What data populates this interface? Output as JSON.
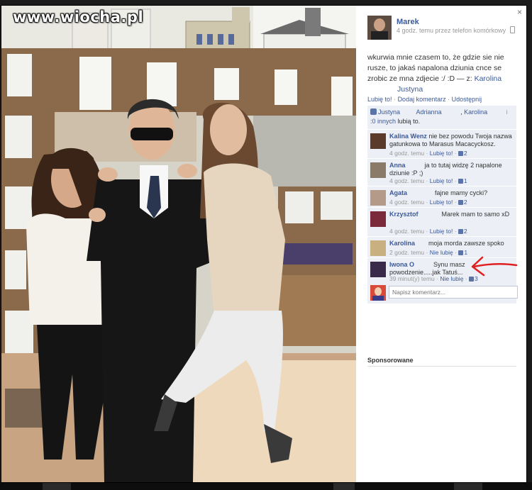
{
  "watermark": "www.wiocha.pl",
  "close_label": "×",
  "author": {
    "name": "Marek",
    "meta": "4 godz. temu przez telefon komórkowy"
  },
  "post": {
    "text_before": "wkurwia mnie czasem to, że gdzie sie nie rusze, to jakaś napalona dziunia cnce se zrobic ze mna zdjecie :/ :D — z: ",
    "tag1": "Karolina",
    "tag2": "Justyna"
  },
  "actions": {
    "like": "Lubię to!",
    "comment": "Dodaj komentarz",
    "share": "Udostępnij",
    "separator": "·"
  },
  "likes": {
    "names": [
      "Justyna",
      "Adrianna",
      "Karolina"
    ],
    "others": ":0 innych",
    "suffix": "lubią to."
  },
  "comments": [
    {
      "name": "Kalina Wenz",
      "text": "nie bez powodu Twoja nazwa gatunkowa to Marasus Macacyckosz.",
      "time": "4 godz. temu",
      "like": "Lubię to!",
      "likes": "2",
      "avatar_color": "#5a3a2a"
    },
    {
      "name": "Anna",
      "text": "ja to tutaj widzę 2 napalone dziunie :P ;)",
      "time": "4 godz. temu",
      "like": "Lubię to!",
      "likes": "1",
      "avatar_color": "#8a7a6a"
    },
    {
      "name": "Agata",
      "text": "fajne mamy cycki?",
      "time": "4 godz. temu",
      "like": "Lubię to!",
      "likes": "2",
      "avatar_color": "#b49a88"
    },
    {
      "name": "Krzysztof",
      "text": "Marek mam to samo xD",
      "time": "4 godz. temu",
      "like": "Lubię to!",
      "likes": "2",
      "avatar_color": "#7a2a3a"
    },
    {
      "name": "Karolina",
      "text": "moja morda zawsze spoko",
      "time": "2 godz. temu",
      "like": "Nie lubię",
      "likes": "1",
      "avatar_color": "#c8b080"
    },
    {
      "name": "Iwona O",
      "text": "Synu masz powodzenie.....jak Tatuś...",
      "time": "39 minut(y) temu",
      "like": "Nie lubię",
      "likes": "3",
      "avatar_color": "#3a2a4a"
    }
  ],
  "write_comment": {
    "placeholder": "Napisz komentarz..."
  },
  "sponsored": "Sponsorowane",
  "colors": {
    "link": "#3b5998",
    "panel": "#eceff5",
    "arrow": "#e02020"
  }
}
